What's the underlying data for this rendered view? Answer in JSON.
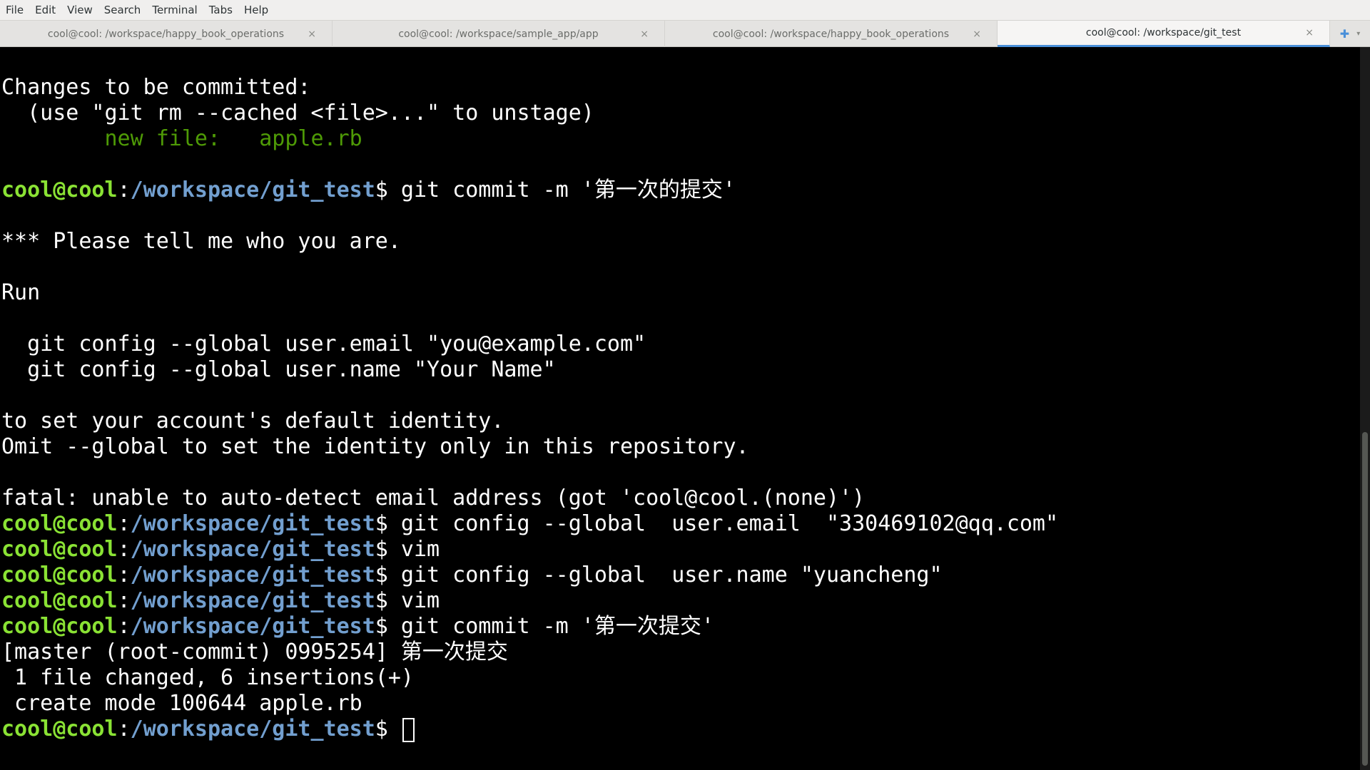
{
  "menu": [
    "File",
    "Edit",
    "View",
    "Search",
    "Terminal",
    "Tabs",
    "Help"
  ],
  "tabs": [
    {
      "label": "cool@cool: /workspace/happy_book_operations",
      "close": "×",
      "active": false
    },
    {
      "label": "cool@cool: /workspace/sample_app/app",
      "close": "×",
      "active": false
    },
    {
      "label": "cool@cool: /workspace/happy_book_operations",
      "close": "×",
      "active": false
    },
    {
      "label": "cool@cool: /workspace/git_test",
      "close": "×",
      "active": true
    }
  ],
  "tab_controls": {
    "new_tab_icon": "✚",
    "menu_icon": "▾"
  },
  "colors": {
    "prompt_user": "#8ae234",
    "prompt_path": "#729fcf",
    "staged_file": "#4e9a06",
    "active_tab_accent": "#4a90d9"
  },
  "terminal": {
    "prompt_user": "cool@cool",
    "prompt_path": "/workspace/git_test",
    "lines": {
      "l1": "Changes to be committed:",
      "l2": "  (use \"git rm --cached <file>...\" to unstage)",
      "l3": "        new file:   apple.rb",
      "cmd1": " git commit -m '第一次的提交'",
      "l5": "*** Please tell me who you are.",
      "l6": "Run",
      "l7": "  git config --global user.email \"you@example.com\"",
      "l8": "  git config --global user.name \"Your Name\"",
      "l9": "to set your account's default identity.",
      "l10": "Omit --global to set the identity only in this repository.",
      "l11": "fatal: unable to auto-detect email address (got 'cool@cool.(none)')",
      "cmd2": " git config --global  user.email  \"330469102@qq.com\"",
      "cmd3": " vim",
      "cmd4": " git config --global  user.name \"yuancheng\"",
      "cmd5": " vim",
      "cmd6": " git commit -m '第一次提交'",
      "l12": "[master (root-commit) 0995254] 第一次提交",
      "l13": " 1 file changed, 6 insertions(+)",
      "l14": " create mode 100644 apple.rb",
      "cmd7": " "
    }
  }
}
